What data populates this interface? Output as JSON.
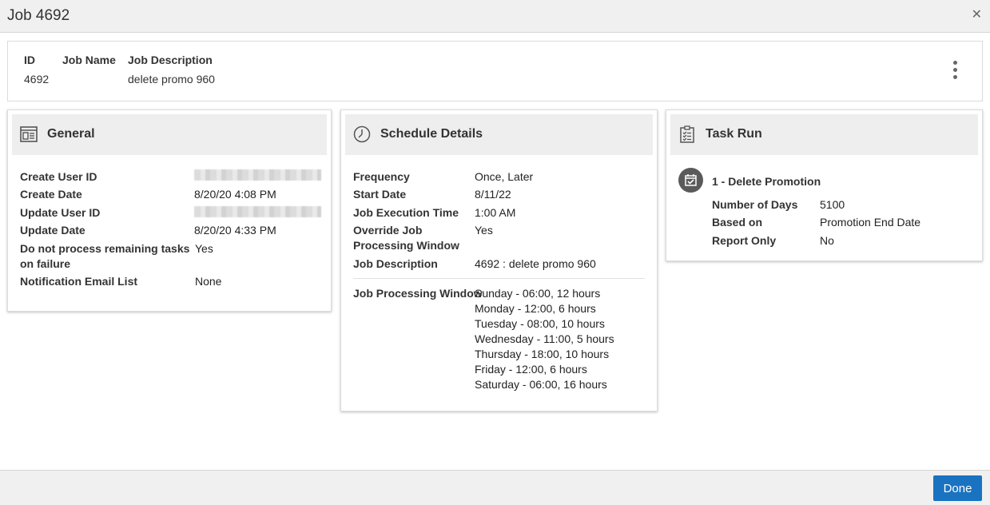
{
  "window": {
    "title": "Job 4692",
    "close_glyph": "✕"
  },
  "header": {
    "columns": [
      {
        "label": "ID",
        "value": "4692"
      },
      {
        "label": "Job Name",
        "value": ""
      },
      {
        "label": "Job Description",
        "value": "delete promo 960"
      }
    ],
    "menu_icon": "more-vertical-icon"
  },
  "general": {
    "title": "General",
    "icon": "general-details-icon",
    "rows": [
      {
        "label": "Create User ID",
        "value": ""
      },
      {
        "label": "Create Date",
        "value": "8/20/20 4:08 PM"
      },
      {
        "label": "Update User ID",
        "value": ""
      },
      {
        "label": "Update Date",
        "value": "8/20/20 4:33 PM"
      },
      {
        "label_line1": "Do not process remaining tasks",
        "label_line2": "on failure",
        "value": "Yes"
      },
      {
        "label": "Notification Email List",
        "value": "None"
      }
    ]
  },
  "schedule": {
    "title": "Schedule Details",
    "icon": "clock-icon",
    "rows": [
      {
        "label": "Frequency",
        "value": "Once, Later"
      },
      {
        "label": "Start Date",
        "value": "8/11/22"
      },
      {
        "label": "Job Execution Time",
        "value": "1:00 AM"
      },
      {
        "label_line1": "Override Job",
        "label_line2": "Processing Window",
        "value": "Yes"
      },
      {
        "label": "Job Description",
        "value": "4692 : delete promo 960"
      }
    ],
    "window_label": "Job Processing Window",
    "window_values": [
      "Sunday - 06:00, 12 hours",
      "Monday - 12:00, 6 hours",
      "Tuesday - 08:00, 10 hours",
      "Wednesday - 11:00, 5 hours",
      "Thursday - 18:00, 10 hours",
      "Friday - 12:00, 6 hours",
      "Saturday - 06:00, 16 hours"
    ]
  },
  "task_run": {
    "title": "Task Run",
    "icon": "clipboard-checklist-icon",
    "task_icon": "calendar-check-icon",
    "task_title": "1 - Delete Promotion",
    "rows": [
      {
        "label": "Number of Days",
        "value": "5100"
      },
      {
        "label": "Based on",
        "value": "Promotion End Date"
      },
      {
        "label": "Report Only",
        "value": "No"
      }
    ]
  },
  "footer": {
    "done_label": "Done"
  },
  "colors": {
    "primary_button": "#1a73c0",
    "header_bg": "#f0f0f0",
    "card_head_bg": "#eeeeee"
  }
}
